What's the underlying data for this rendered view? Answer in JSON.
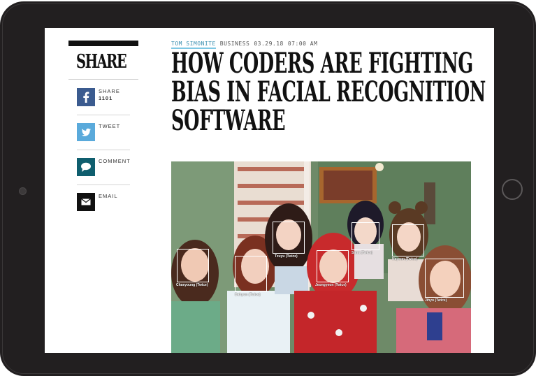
{
  "share": {
    "title": "SHARE",
    "items": [
      {
        "label": "SHARE",
        "count": "1101",
        "icon": "facebook-icon",
        "color": "#3b5b8f"
      },
      {
        "label": "TWEET",
        "icon": "twitter-icon",
        "color": "#5aaadb"
      },
      {
        "label": "COMMENT",
        "icon": "comment-icon",
        "color": "#0f5e6e"
      },
      {
        "label": "EMAIL",
        "icon": "email-icon",
        "color": "#111111"
      }
    ]
  },
  "article": {
    "author": "TOM SIMONITE",
    "section": "BUSINESS",
    "date": "03.29.18",
    "time": "07:00 AM",
    "headline_lines": [
      "HOW CODERS ARE FIGHTING",
      "BIAS IN FACIAL RECOGNITION",
      "SOFTWARE"
    ]
  },
  "photo": {
    "faces": [
      {
        "label": "Chaeyoung (Twice)"
      },
      {
        "label": "Dahyun (Twice)"
      },
      {
        "label": "Tzuyu (Twice)"
      },
      {
        "label": "Jeongyeon (Twice)"
      },
      {
        "label": "Sana (Twice)"
      },
      {
        "label": "Nayeon (Twice)"
      },
      {
        "label": "Jihyo (Twice)"
      }
    ]
  }
}
